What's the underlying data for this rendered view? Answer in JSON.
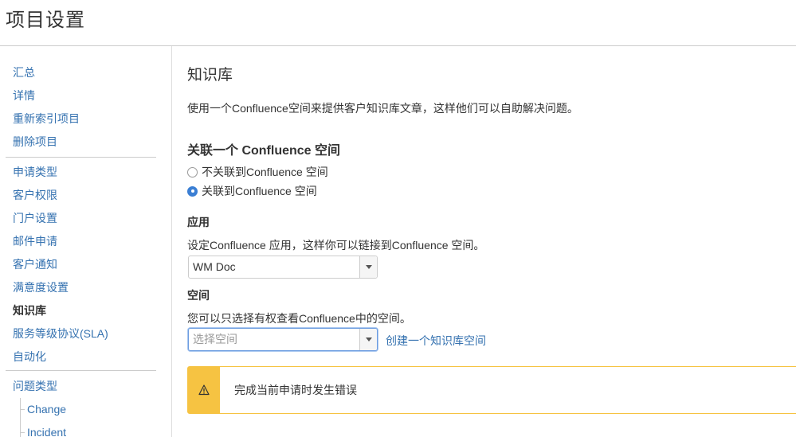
{
  "header": {
    "title": "项目设置"
  },
  "sidebar": {
    "group1": [
      "汇总",
      "详情",
      "重新索引项目",
      "删除项目"
    ],
    "group2": [
      "申请类型",
      "客户权限",
      "门户设置",
      "邮件申请",
      "客户通知",
      "满意度设置",
      "知识库",
      "服务等级协议(SLA)",
      "自动化"
    ],
    "active_item": "知识库",
    "group3": {
      "label": "问题类型",
      "children": [
        "Change",
        "Incident"
      ]
    }
  },
  "main": {
    "title": "知识库",
    "intro": "使用一个Confluence空间来提供客户知识库文章，这样他们可以自助解决问题。",
    "link_section_title": "关联一个 Confluence 空间",
    "radio_options": [
      {
        "label": "不关联到Confluence 空间",
        "checked": false
      },
      {
        "label": "关联到Confluence 空间",
        "checked": true
      }
    ],
    "application": {
      "label": "应用",
      "description": "设定Confluence 应用，这样你可以链接到Confluence 空间。",
      "selected_value": "WM Doc"
    },
    "space": {
      "label": "空间",
      "description": "您可以只选择有权查看Confluence中的空间。",
      "placeholder": "选择空间",
      "create_link": "创建一个知识库空间"
    },
    "warning": {
      "message": "完成当前申请时发生错误",
      "icon": "warning-icon"
    }
  },
  "colors": {
    "link": "#3572b0",
    "warning": "#f6c342",
    "radio_checked": "#3b7fd4"
  }
}
